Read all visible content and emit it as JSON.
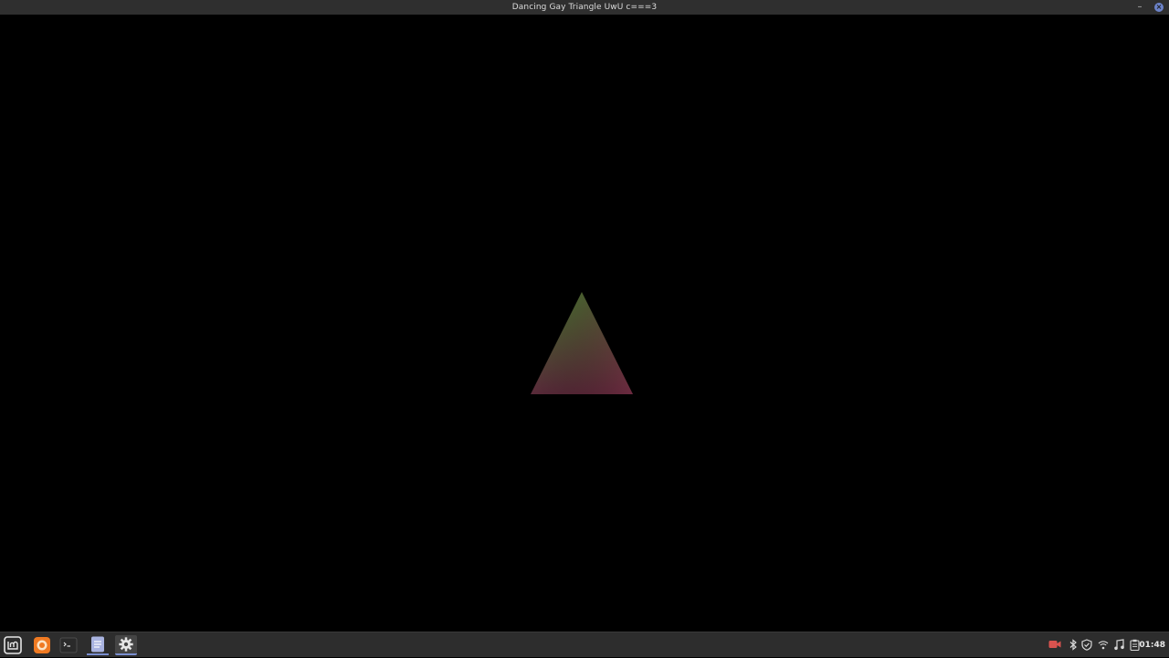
{
  "window": {
    "title": "Dancing Gay Triangle UwU c===3",
    "minimize_glyph": "–",
    "close_glyph": "×"
  },
  "scene": {
    "background": "#000000",
    "triangle_colors": {
      "top": "#4e7a34",
      "bottom_left": "#5a2a3a",
      "bottom_right": "#7a2a44"
    }
  },
  "taskbar": {
    "launchers": [
      {
        "name": "menu",
        "icon": "linux-mint-icon"
      },
      {
        "name": "firefox",
        "icon": "firefox-icon"
      },
      {
        "name": "terminal",
        "icon": "terminal-icon",
        "glyph": "$_"
      },
      {
        "name": "notes",
        "icon": "notes-icon"
      },
      {
        "name": "settings",
        "icon": "gear-icon"
      }
    ],
    "tray": [
      {
        "name": "camera-recording",
        "icon": "camera-icon",
        "color": "#d9534f"
      },
      {
        "name": "bluetooth",
        "icon": "bluetooth-icon"
      },
      {
        "name": "update-manager",
        "icon": "shield-icon"
      },
      {
        "name": "network",
        "icon": "wifi-icon"
      },
      {
        "name": "sound",
        "icon": "music-note-icon"
      },
      {
        "name": "clipboard",
        "icon": "clipboard-icon"
      }
    ],
    "clock": "01:48"
  },
  "colors": {
    "titlebar": "#2f2f2f",
    "taskbar": "#2d2d2d",
    "accent": "#6c83c9"
  }
}
